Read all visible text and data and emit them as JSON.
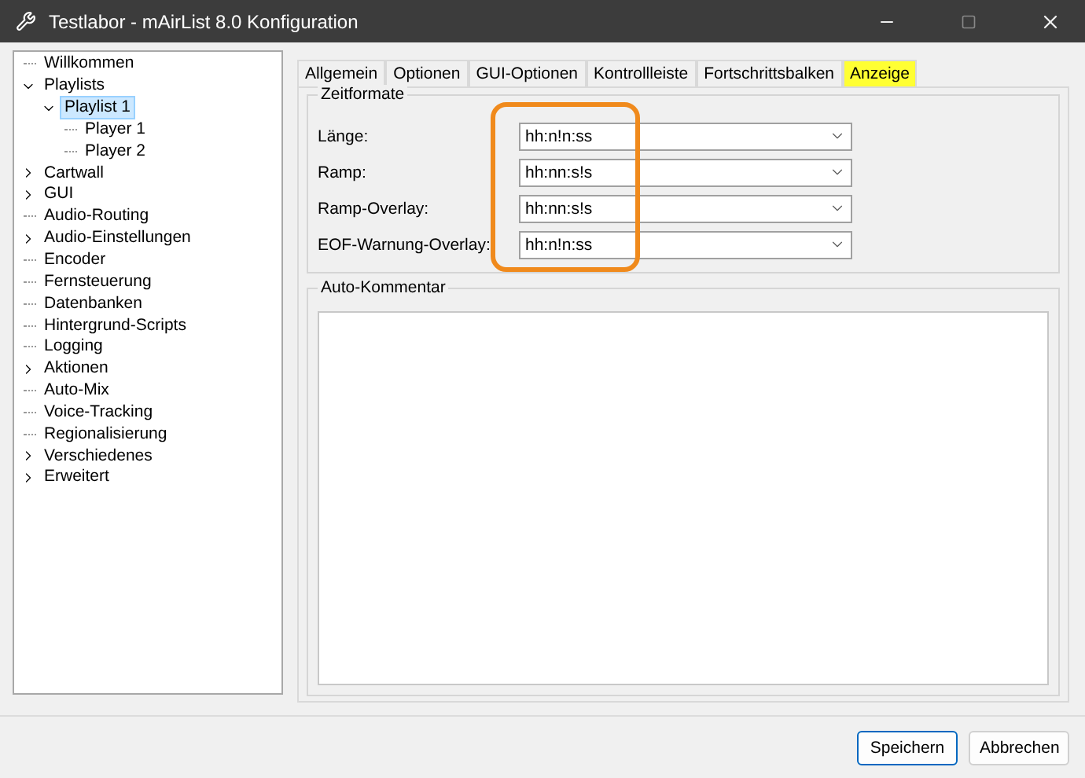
{
  "window": {
    "title": "Testlabor - mAirList 8.0 Konfiguration"
  },
  "tree": [
    {
      "label": "Willkommen",
      "expandable": false,
      "selected": false
    },
    {
      "label": "Playlists",
      "expandable": true,
      "expanded": true,
      "selected": false,
      "children": [
        {
          "label": "Playlist 1",
          "expandable": true,
          "expanded": true,
          "selected": true,
          "children": [
            {
              "label": "Player 1",
              "expandable": false,
              "selected": false
            },
            {
              "label": "Player 2",
              "expandable": false,
              "selected": false
            }
          ]
        }
      ]
    },
    {
      "label": "Cartwall",
      "expandable": true,
      "expanded": false,
      "selected": false
    },
    {
      "label": "GUI",
      "expandable": true,
      "expanded": false,
      "selected": false
    },
    {
      "label": "Audio-Routing",
      "expandable": false,
      "selected": false
    },
    {
      "label": "Audio-Einstellungen",
      "expandable": true,
      "expanded": false,
      "selected": false
    },
    {
      "label": "Encoder",
      "expandable": false,
      "selected": false
    },
    {
      "label": "Fernsteuerung",
      "expandable": false,
      "selected": false
    },
    {
      "label": "Datenbanken",
      "expandable": false,
      "selected": false
    },
    {
      "label": "Hintergrund-Scripts",
      "expandable": false,
      "selected": false
    },
    {
      "label": "Logging",
      "expandable": false,
      "selected": false
    },
    {
      "label": "Aktionen",
      "expandable": true,
      "expanded": false,
      "selected": false
    },
    {
      "label": "Auto-Mix",
      "expandable": false,
      "selected": false
    },
    {
      "label": "Voice-Tracking",
      "expandable": false,
      "selected": false
    },
    {
      "label": "Regionalisierung",
      "expandable": false,
      "selected": false
    },
    {
      "label": "Verschiedenes",
      "expandable": true,
      "expanded": false,
      "selected": false
    },
    {
      "label": "Erweitert",
      "expandable": true,
      "expanded": false,
      "selected": false
    }
  ],
  "tabs": [
    {
      "label": "Allgemein",
      "selected": false
    },
    {
      "label": "Optionen",
      "selected": false
    },
    {
      "label": "GUI-Optionen",
      "selected": false
    },
    {
      "label": "Kontrollleiste",
      "selected": false
    },
    {
      "label": "Fortschrittsbalken",
      "selected": false
    },
    {
      "label": "Anzeige",
      "selected": true
    }
  ],
  "zeitformate": {
    "title": "Zeitformate",
    "fields": [
      {
        "label": "Länge:",
        "value": "hh:n!n:ss"
      },
      {
        "label": "Ramp:",
        "value": "hh:nn:s!s"
      },
      {
        "label": "Ramp-Overlay:",
        "value": "hh:nn:s!s"
      },
      {
        "label": "EOF-Warnung-Overlay:",
        "value": "hh:n!n:ss"
      }
    ]
  },
  "auto_kommentar": {
    "title": "Auto-Kommentar"
  },
  "buttons": [
    {
      "label": "Speichern",
      "default": true
    },
    {
      "label": "Abbrechen",
      "default": false
    }
  ]
}
